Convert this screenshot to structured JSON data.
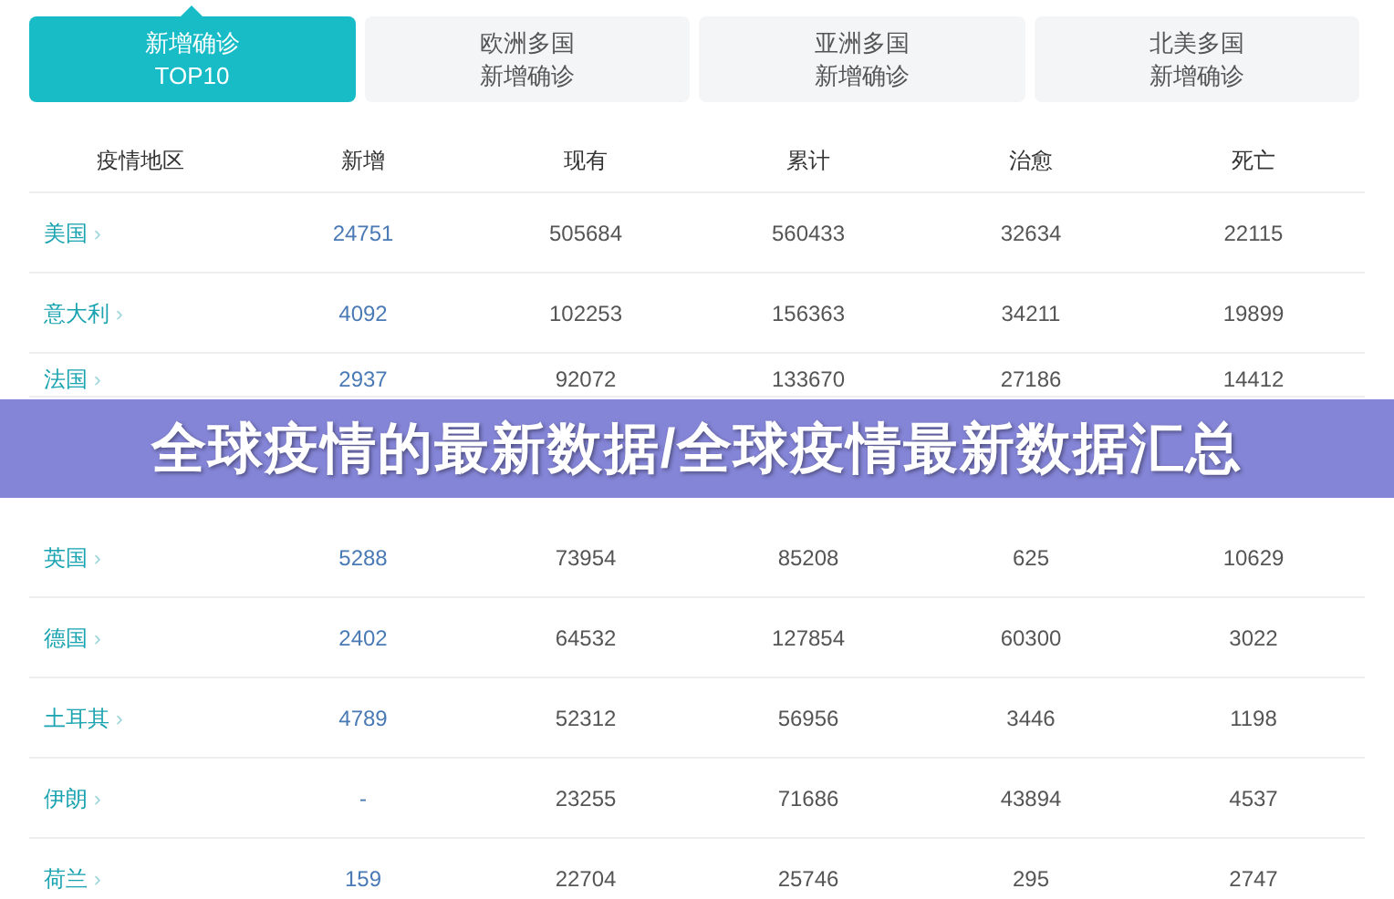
{
  "tabs": [
    {
      "line_1": "新增确诊",
      "line_2": "TOP10",
      "selected": true
    },
    {
      "line_1": "欧洲多国",
      "line_2": "新增确诊",
      "selected": false
    },
    {
      "line_1": "亚洲多国",
      "line_2": "新增确诊",
      "selected": false
    },
    {
      "line_1": "北美多国",
      "line_2": "新增确诊",
      "selected": false
    }
  ],
  "table": {
    "columns": [
      "疫情地区",
      "新增",
      "现有",
      "累计",
      "治愈",
      "死亡"
    ],
    "rows_above_banner": [
      {
        "region": "美国",
        "chevron": "›",
        "values": [
          "24751",
          "505684",
          "560433",
          "32634",
          "22115"
        ]
      },
      {
        "region": "意大利",
        "chevron": "›",
        "values": [
          "4092",
          "102253",
          "156363",
          "34211",
          "19899"
        ]
      },
      {
        "region": "法国",
        "chevron": "›",
        "values": [
          "2937",
          "92072",
          "133670",
          "27186",
          "14412"
        ]
      }
    ],
    "rows_below_banner": [
      {
        "region": "英国",
        "chevron": "›",
        "values": [
          "5288",
          "73954",
          "85208",
          "625",
          "10629"
        ]
      },
      {
        "region": "德国",
        "chevron": "›",
        "values": [
          "2402",
          "64532",
          "127854",
          "60300",
          "3022"
        ]
      },
      {
        "region": "土耳其",
        "chevron": "›",
        "values": [
          "4789",
          "52312",
          "56956",
          "3446",
          "1198"
        ]
      },
      {
        "region": "伊朗",
        "chevron": "›",
        "values": [
          "-",
          "23255",
          "71686",
          "43894",
          "4537"
        ]
      },
      {
        "region": "荷兰",
        "chevron": "›",
        "values": [
          "159",
          "22704",
          "25746",
          "295",
          "2747"
        ]
      }
    ]
  },
  "banner": {
    "title": "全球疫情的最新数据/全球疫情最新数据汇总"
  }
}
